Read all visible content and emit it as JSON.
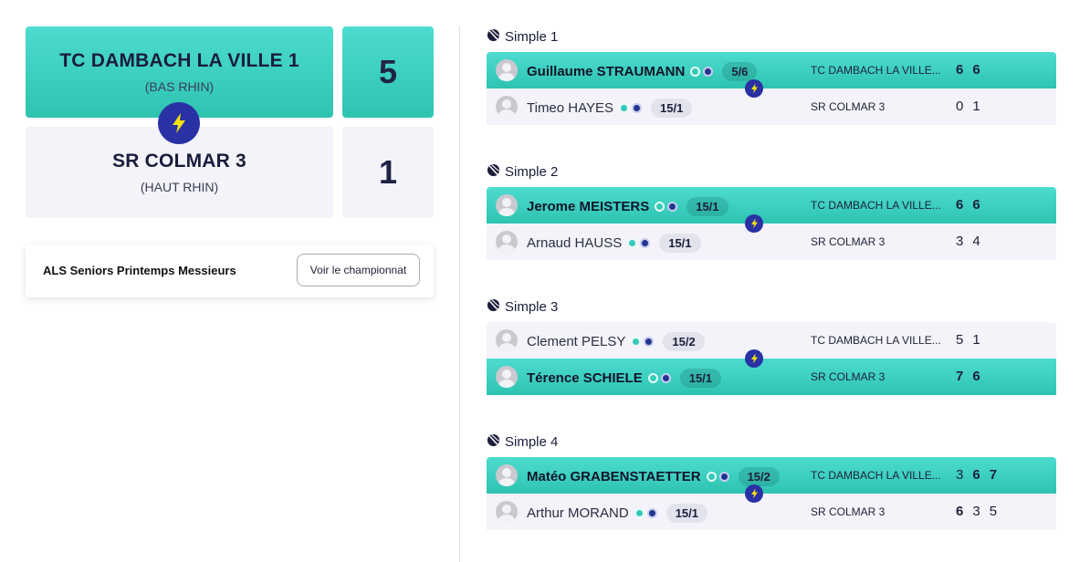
{
  "home": {
    "name": "TC DAMBACH LA VILLE 1",
    "region": "(BAS RHIN)",
    "score": "5"
  },
  "away": {
    "name": "SR COLMAR 3",
    "region": "(HAUT RHIN)",
    "score": "1"
  },
  "championship": {
    "title": "ALS Seniors Printemps Messieurs",
    "button_label": "Voir le championnat"
  },
  "colors": {
    "accent_teal": "#3fd1c3",
    "badge_blue": "#2a31a4",
    "bolt_yellow": "#f4e20b",
    "light_bg": "#f3f3f9"
  },
  "matches": [
    {
      "title": "Simple 1",
      "rows": [
        {
          "name": "Guillaume STRAUMANN",
          "rank": "5/6",
          "club": "TC DAMBACH LA VILLE...",
          "sets": [
            "6",
            "6"
          ],
          "winner": true
        },
        {
          "name": "Timeo HAYES",
          "rank": "15/1",
          "club": "SR COLMAR 3",
          "sets": [
            "0",
            "1"
          ],
          "winner": false
        }
      ]
    },
    {
      "title": "Simple 2",
      "rows": [
        {
          "name": "Jerome MEISTERS",
          "rank": "15/1",
          "club": "TC DAMBACH LA VILLE...",
          "sets": [
            "6",
            "6"
          ],
          "winner": true
        },
        {
          "name": "Arnaud HAUSS",
          "rank": "15/1",
          "club": "SR COLMAR 3",
          "sets": [
            "3",
            "4"
          ],
          "winner": false
        }
      ]
    },
    {
      "title": "Simple 3",
      "rows": [
        {
          "name": "Clement PELSY",
          "rank": "15/2",
          "club": "TC DAMBACH LA VILLE...",
          "sets": [
            "5",
            "1"
          ],
          "winner": false
        },
        {
          "name": "Térence SCHIELE",
          "rank": "15/1",
          "club": "SR COLMAR 3",
          "sets": [
            "7",
            "6"
          ],
          "winner": true
        }
      ]
    },
    {
      "title": "Simple 4",
      "rows": [
        {
          "name": "Matéo GRABENSTAETTER",
          "rank": "15/2",
          "club": "TC DAMBACH LA VILLE...",
          "sets": [
            "3",
            "6",
            "7"
          ],
          "winner": true
        },
        {
          "name": "Arthur MORAND",
          "rank": "15/1",
          "club": "SR COLMAR 3",
          "sets": [
            "6",
            "3",
            "5"
          ],
          "winner": false
        }
      ]
    }
  ]
}
